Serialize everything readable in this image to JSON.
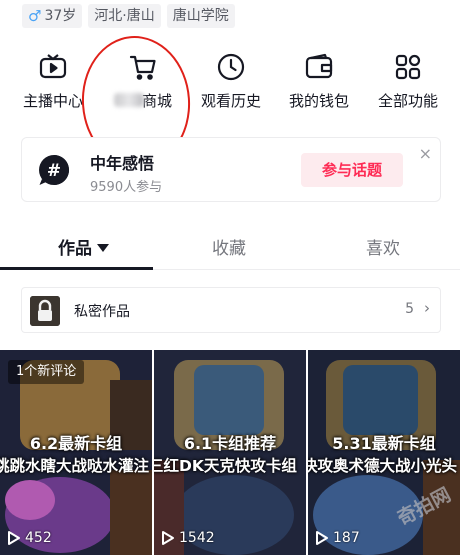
{
  "profile_tags": [
    {
      "icon": "male-icon",
      "label": "37岁"
    },
    {
      "label": "河北·唐山"
    },
    {
      "label": "唐山学院"
    }
  ],
  "features": [
    {
      "icon": "tv-icon",
      "label": "主播中心"
    },
    {
      "icon": "cart-icon",
      "label": "商城",
      "blurred_prefix": true
    },
    {
      "icon": "clock-icon",
      "label": "观看历史"
    },
    {
      "icon": "wallet-icon",
      "label": "我的钱包"
    },
    {
      "icon": "grid-icon",
      "label": "全部功能"
    }
  ],
  "annotation_color": "#e0211a",
  "topic": {
    "title": "中年感悟",
    "participants": "9590人参与",
    "join_label": "参与话题",
    "close_symbol": "×"
  },
  "tabs": [
    {
      "label": "作品",
      "active": true
    },
    {
      "label": "收藏"
    },
    {
      "label": "喜欢"
    }
  ],
  "private_works": {
    "label": "私密作品",
    "count": "5",
    "chevron": "›"
  },
  "videos": [
    {
      "badge": "1个新评论",
      "line1": "6.2最新卡组",
      "line2": "跳跳水瞎大战哒水灌注",
      "plays": "452"
    },
    {
      "line1": "6.1卡组推荐",
      "line2": "三红DK天克快攻卡组",
      "plays": "1542"
    },
    {
      "line1": "5.31最新卡组",
      "line2": "快攻奥术德大战小光头",
      "plays": "187"
    }
  ],
  "watermark": "奇拍网",
  "colors": {
    "accent": "#fe2c55",
    "text": "#161823",
    "muted": "#75777e"
  }
}
